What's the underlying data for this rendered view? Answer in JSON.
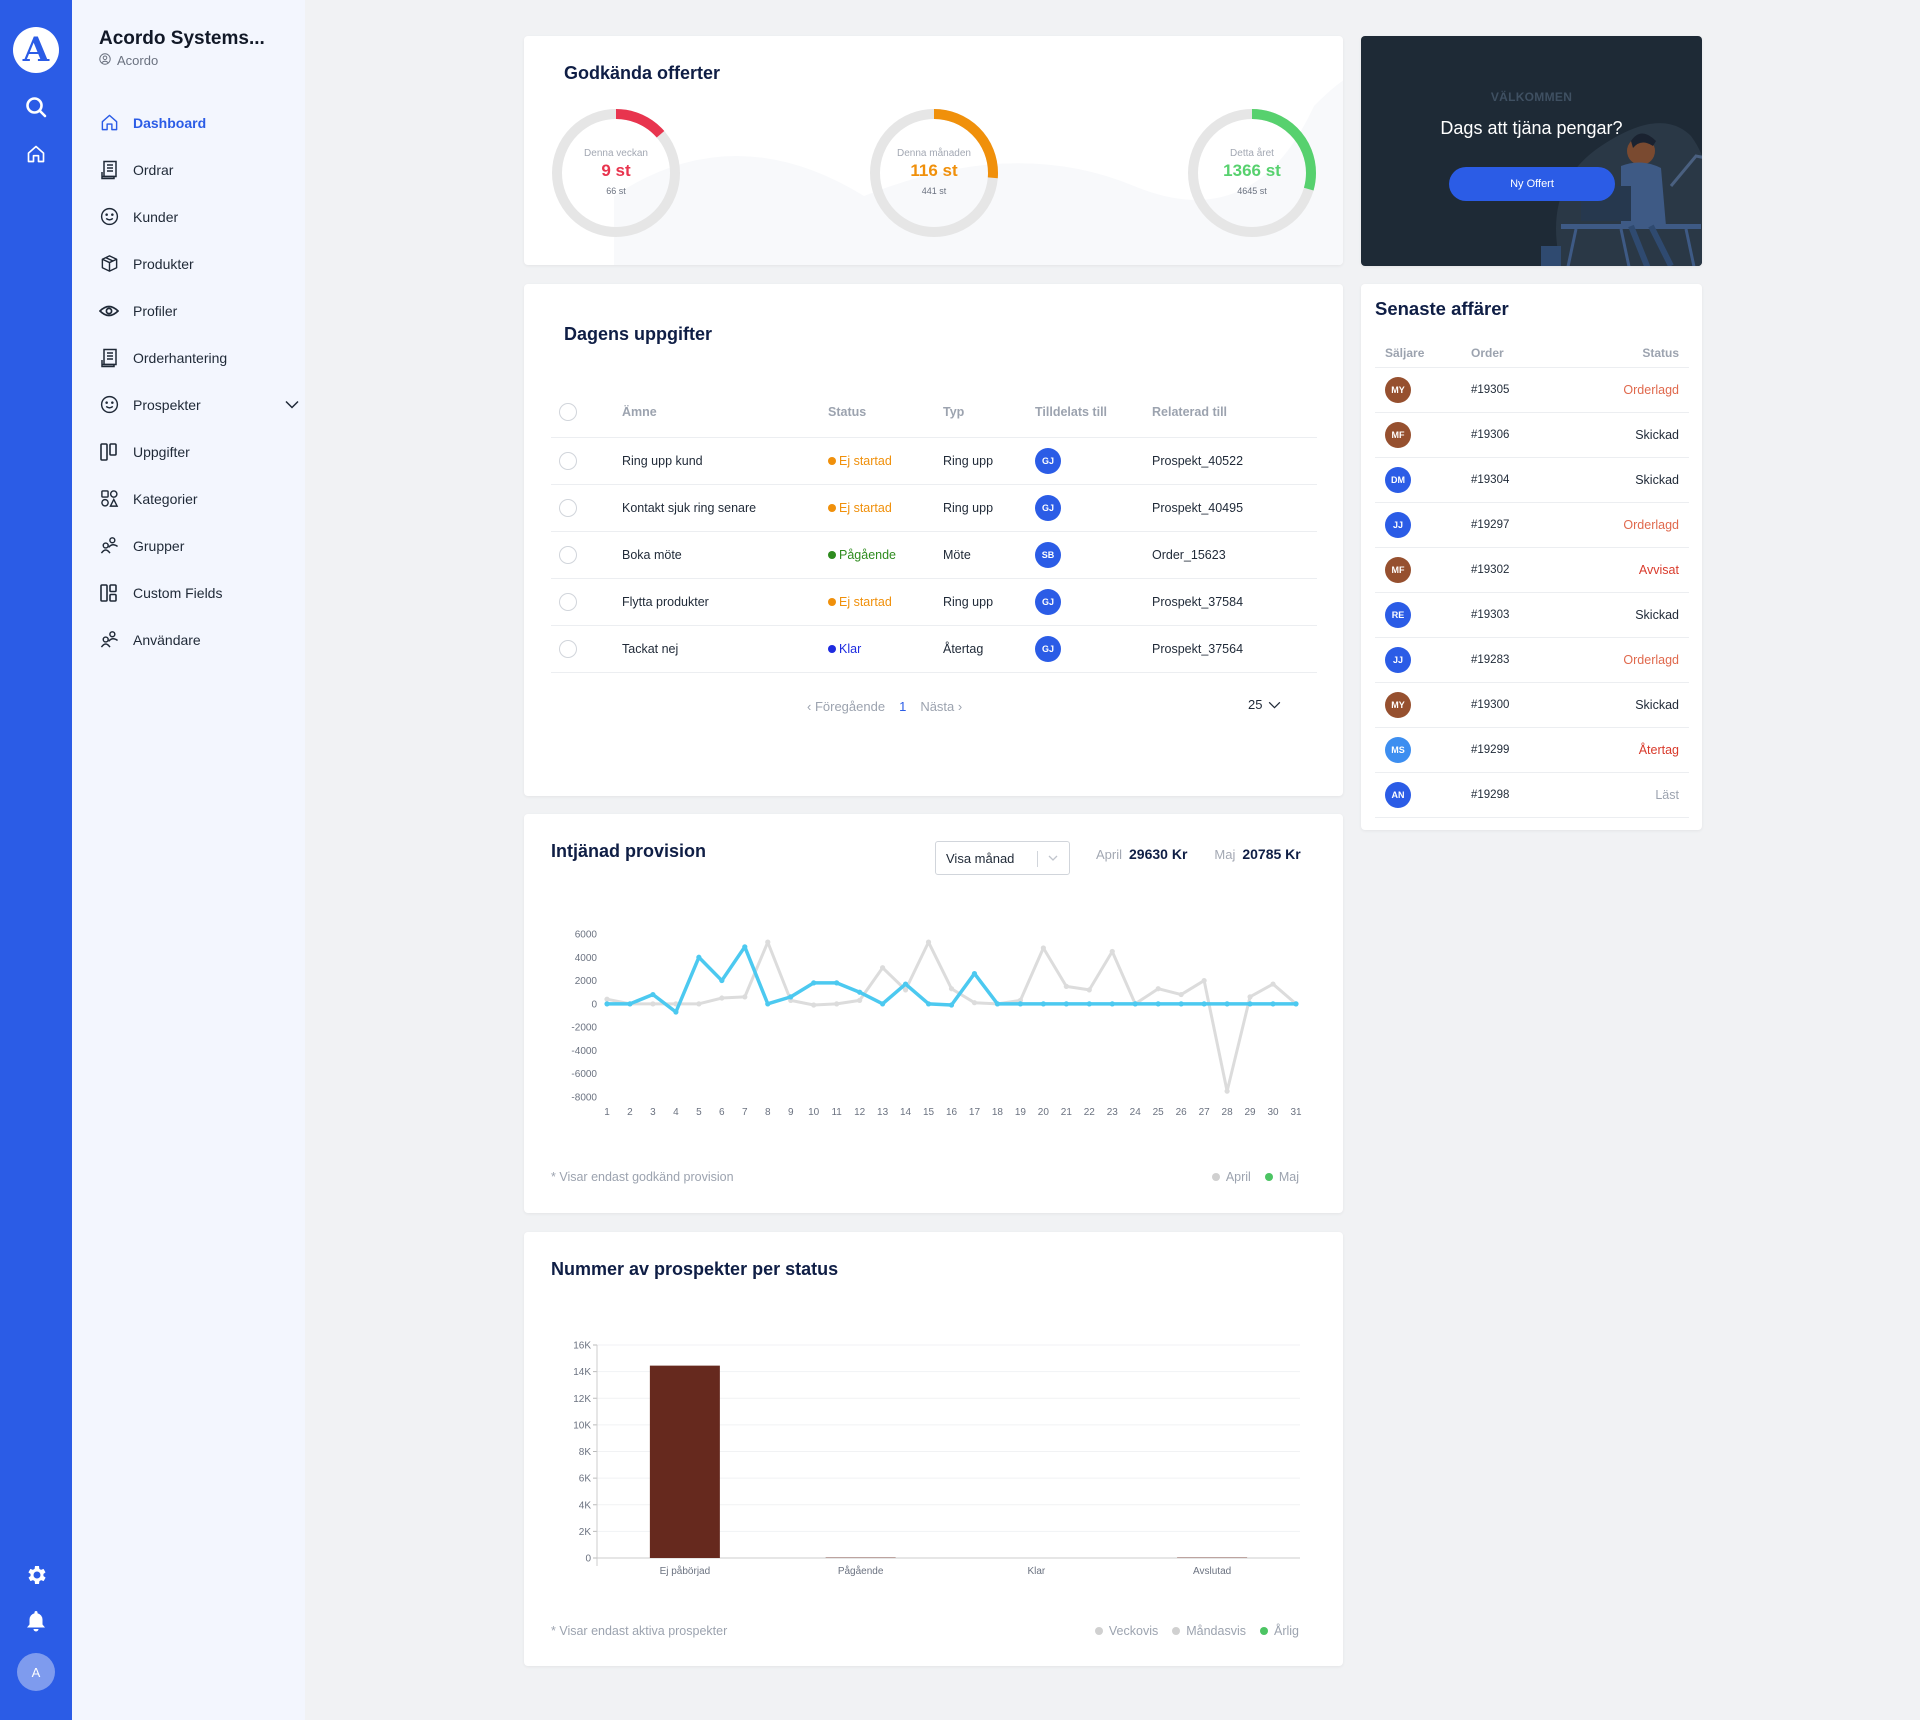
{
  "rail": {
    "logo_letter": "A",
    "avatar_initial": "A",
    "icons": [
      "search-icon",
      "home-icon",
      "gear-icon",
      "bell-icon"
    ]
  },
  "sidebar": {
    "org_name": "Acordo Systems...",
    "org_sub": "Acordo",
    "items": [
      {
        "label": "Dashboard",
        "icon": "home-icon",
        "active": true
      },
      {
        "label": "Ordrar",
        "icon": "receipt-icon"
      },
      {
        "label": "Kunder",
        "icon": "smiley-icon"
      },
      {
        "label": "Produkter",
        "icon": "box-icon"
      },
      {
        "label": "Profiler",
        "icon": "eye-icon"
      },
      {
        "label": "Orderhantering",
        "icon": "receipt-icon"
      },
      {
        "label": "Prospekter",
        "icon": "smiley-icon",
        "expandable": true
      },
      {
        "label": "Uppgifter",
        "icon": "columns-icon"
      },
      {
        "label": "Kategorier",
        "icon": "shapes-icon"
      },
      {
        "label": "Grupper",
        "icon": "users-icon"
      },
      {
        "label": "Custom Fields",
        "icon": "layout-icon"
      },
      {
        "label": "Användare",
        "icon": "users-icon"
      }
    ]
  },
  "approved_offers": {
    "title": "Godkända offerter",
    "donuts": [
      {
        "label": "Denna veckan",
        "value": "9 st",
        "total": "66 st",
        "fraction": 0.136,
        "color": "#E8344E"
      },
      {
        "label": "Denna månaden",
        "value": "116 st",
        "total": "441 st",
        "fraction": 0.263,
        "color": "#F0900B"
      },
      {
        "label": "Detta året",
        "value": "1366 st",
        "total": "4645 st",
        "fraction": 0.294,
        "color": "#57D16E"
      }
    ]
  },
  "welcome": {
    "kicker": "VÄLKOMMEN",
    "title": "Dags att tjäna pengar?",
    "button": "Ny Offert"
  },
  "tasks": {
    "title": "Dagens uppgifter",
    "columns": [
      "Ämne",
      "Status",
      "Typ",
      "Tilldelats till",
      "Relaterad till"
    ],
    "rows": [
      {
        "subject": "Ring upp kund",
        "status": "Ej startad",
        "status_color": "#F0900B",
        "type": "Ring upp",
        "assignee": "GJ",
        "related": "Prospekt_40522"
      },
      {
        "subject": "Kontakt sjuk ring senare",
        "status": "Ej startad",
        "status_color": "#F0900B",
        "type": "Ring upp",
        "assignee": "GJ",
        "related": "Prospekt_40495"
      },
      {
        "subject": "Boka möte",
        "status": "Pågående",
        "status_color": "#2E8B1E",
        "type": "Möte",
        "assignee": "SB",
        "related": "Order_15623"
      },
      {
        "subject": "Flytta produkter",
        "status": "Ej startad",
        "status_color": "#F0900B",
        "type": "Ring upp",
        "assignee": "GJ",
        "related": "Prospekt_37584"
      },
      {
        "subject": "Tackat nej",
        "status": "Klar",
        "status_color": "#1E2BE0",
        "type": "Återtag",
        "assignee": "GJ",
        "related": "Prospekt_37564"
      }
    ],
    "pager": {
      "prev": "Föregående",
      "page": "1",
      "next": "Nästa",
      "per_page": "25"
    }
  },
  "recent_deals": {
    "title": "Senaste affärer",
    "columns": [
      "Säljare",
      "Order",
      "Status"
    ],
    "rows": [
      {
        "seller": "MY",
        "seller_color": "#96502F",
        "order": "#19305",
        "status": "Orderlagd",
        "status_color": "#E0694D"
      },
      {
        "seller": "MF",
        "seller_color": "#96502F",
        "order": "#19306",
        "status": "Skickad",
        "status_color": "#1f2937"
      },
      {
        "seller": "DM",
        "seller_color": "#2B5CE6",
        "order": "#19304",
        "status": "Skickad",
        "status_color": "#1f2937"
      },
      {
        "seller": "JJ",
        "seller_color": "#2B5CE6",
        "order": "#19297",
        "status": "Orderlagd",
        "status_color": "#E0694D"
      },
      {
        "seller": "MF",
        "seller_color": "#96502F",
        "order": "#19302",
        "status": "Avvisat",
        "status_color": "#D93A2B"
      },
      {
        "seller": "RE",
        "seller_color": "#2B5CE6",
        "order": "#19303",
        "status": "Skickad",
        "status_color": "#1f2937"
      },
      {
        "seller": "JJ",
        "seller_color": "#2B5CE6",
        "order": "#19283",
        "status": "Orderlagd",
        "status_color": "#E0694D"
      },
      {
        "seller": "MY",
        "seller_color": "#96502F",
        "order": "#19300",
        "status": "Skickad",
        "status_color": "#1f2937"
      },
      {
        "seller": "MS",
        "seller_color": "#3D8EF0",
        "order": "#19299",
        "status": "Återtag",
        "status_color": "#D93A2B"
      },
      {
        "seller": "AN",
        "seller_color": "#2B5CE6",
        "order": "#19298",
        "status": "Läst",
        "status_color": "#9ca3af"
      }
    ]
  },
  "commission": {
    "title": "Intjänad provision",
    "select_value": "Visa månad",
    "sums": [
      {
        "label": "April",
        "value": "29630 Kr"
      },
      {
        "label": "Maj",
        "value": "20785 Kr"
      }
    ],
    "note": "* Visar endast godkänd provision",
    "legend": [
      {
        "label": "April",
        "color": "#D0D0D0"
      },
      {
        "label": "Maj",
        "color": "#4CC463"
      }
    ]
  },
  "prospects": {
    "title": "Nummer av prospekter per status",
    "note": "* Visar endast aktiva prospekter",
    "legend": [
      {
        "label": "Veckovis",
        "color": "#D0D0D0"
      },
      {
        "label": "Måndasvis",
        "color": "#D0D0D0"
      },
      {
        "label": "Årlig",
        "color": "#4CC463"
      }
    ]
  },
  "chart_data": [
    {
      "type": "line",
      "title": "Intjänad provision",
      "x": [
        1,
        2,
        3,
        4,
        5,
        6,
        7,
        8,
        9,
        10,
        11,
        12,
        13,
        14,
        15,
        16,
        17,
        18,
        19,
        20,
        21,
        22,
        23,
        24,
        25,
        26,
        27,
        28,
        29,
        30,
        31
      ],
      "series": [
        {
          "name": "April",
          "color": "#DCDCDC",
          "values": [
            400,
            0,
            0,
            0,
            0,
            500,
            600,
            5300,
            300,
            -100,
            0,
            300,
            3100,
            1200,
            5300,
            1300,
            100,
            0,
            300,
            4800,
            1500,
            1200,
            4500,
            0,
            1300,
            800,
            2000,
            -7500,
            600,
            1700,
            0
          ]
        },
        {
          "name": "Maj",
          "color": "#4CC9F0",
          "values": [
            0,
            0,
            800,
            -700,
            4000,
            2000,
            4900,
            0,
            600,
            1800,
            1800,
            1000,
            0,
            1700,
            0,
            -100,
            2600,
            0,
            0,
            0,
            0,
            0,
            0,
            0,
            0,
            0,
            0,
            0,
            0,
            0,
            0
          ]
        }
      ],
      "yticks": [
        6000,
        4000,
        2000,
        0,
        -2000,
        -4000,
        -6000,
        -8000
      ],
      "ylim": [
        -8000,
        6000
      ],
      "xlabel": "",
      "ylabel": "",
      "grid": false,
      "legend": "bottom-right"
    },
    {
      "type": "bar",
      "title": "Nummer av prospekter per status",
      "categories": [
        "Ej påbörjad",
        "Pågående",
        "Klar",
        "Avslutad"
      ],
      "series": [
        {
          "name": "Årlig",
          "color": "#66291E",
          "values": [
            14450,
            30,
            0,
            30
          ]
        }
      ],
      "yticks": [
        "0",
        "2K",
        "4K",
        "6K",
        "8K",
        "10K",
        "12K",
        "14K",
        "16K"
      ],
      "ylim": [
        0,
        16000
      ],
      "xlabel": "",
      "ylabel": "",
      "grid": true,
      "legend": "bottom-right"
    }
  ]
}
